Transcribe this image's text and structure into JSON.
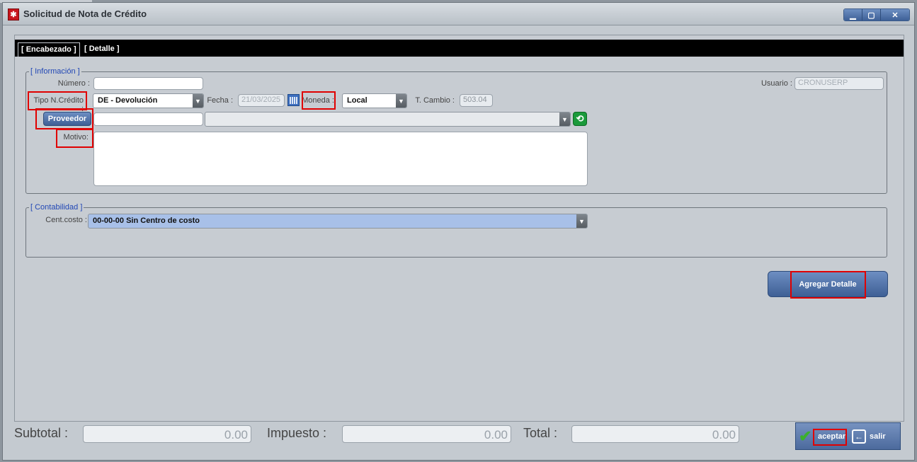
{
  "window": {
    "title": "Solicitud de Nota de Crédito",
    "controls": {
      "minimize": "▁",
      "maximize": "▢",
      "close": "✕"
    }
  },
  "tabs": [
    {
      "label": "[ Encabezado ]",
      "active": true
    },
    {
      "label": "[ Detalle ]",
      "active": false
    }
  ],
  "informacion": {
    "legend": "[ Información ]",
    "numero_label": "Número :",
    "numero_value": "",
    "usuario_label": "Usuario :",
    "usuario_value": "CRONUSERP",
    "tipo_label": "Tipo N.Crédito :",
    "tipo_value": "DE - Devolución",
    "fecha_label": "Fecha :",
    "fecha_value": "21/03/2025",
    "moneda_label": "Moneda :",
    "moneda_value": "Local",
    "tcambio_label": "T. Cambio :",
    "tcambio_value": "503.04",
    "proveedor_button": "Proveedor",
    "proveedor_code": "",
    "proveedor_name": "",
    "motivo_label": "Motivo:",
    "motivo_value": ""
  },
  "contabilidad": {
    "legend": "[ Contabilidad ]",
    "centcosto_label": "Cent.costo :",
    "centcosto_value": "00-00-00 Sin Centro de costo"
  },
  "agregar_detalle_button": "Agregar Detalle",
  "totals": {
    "subtotal_label": "Subtotal :",
    "subtotal_value": "0.00",
    "impuesto_label": "Impuesto :",
    "impuesto_value": "0.00",
    "total_label": "Total :",
    "total_value": "0.00"
  },
  "actions": {
    "aceptar": "aceptar",
    "salir": "salir"
  },
  "colors": {
    "accent_blue": "#3e5f95",
    "legend_blue": "#2147b5",
    "highlight_red": "#e00000",
    "select_highlight": "#a8c0e8"
  }
}
